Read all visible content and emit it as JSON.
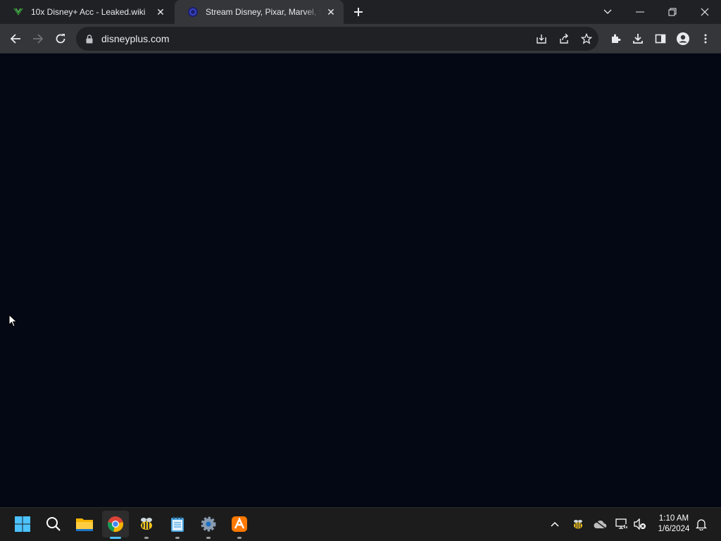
{
  "browser": {
    "tabs": [
      {
        "title": "10x Disney+ Acc - Leaked.wiki",
        "favicon": "leaked-wiki-icon",
        "active": false
      },
      {
        "title": "Stream Disney, Pixar, Marvel, Sta",
        "favicon": "disney-plus-icon",
        "active": true
      }
    ],
    "url": "disneyplus.com"
  },
  "page": {
    "background_color": "#040714"
  },
  "taskbar": {
    "apps": [
      "start-icon",
      "search-icon",
      "file-explorer-icon",
      "chrome-icon",
      "bee-app-icon",
      "notepad-icon",
      "settings-icon",
      "avast-icon"
    ],
    "clock": {
      "time": "1:10 AM",
      "date": "1/6/2024"
    }
  }
}
